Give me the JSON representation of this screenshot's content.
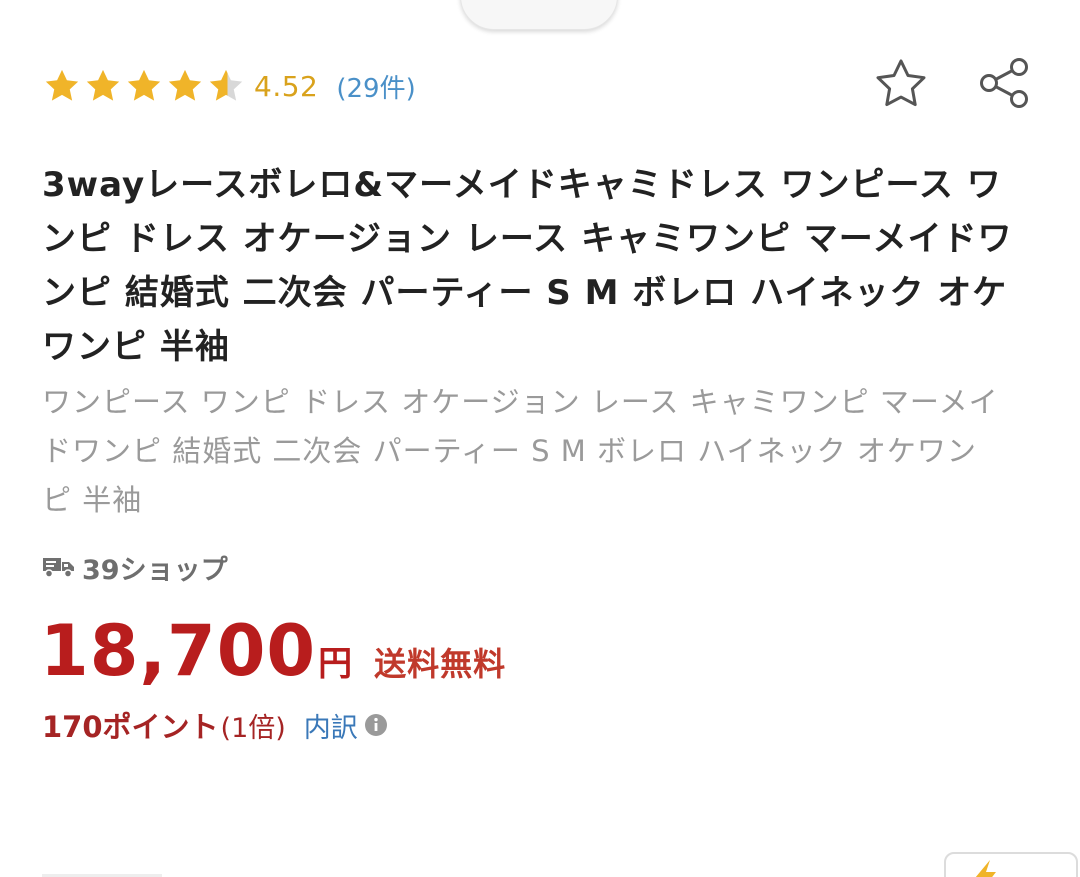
{
  "rating": {
    "value": "4.52",
    "count_label": "(29件)",
    "stars_filled": 4.5
  },
  "actions": {
    "favorite_icon": "star-outline-icon",
    "share_icon": "share-icon"
  },
  "product": {
    "title": "3wayレースボレロ&マーメイドキャミドレス ワンピース ワンピ ドレス オケージョン レース キャミワンピ マーメイドワンピ 結婚式 二次会 パーティー S M ボレロ ハイネック オケワンピ 半袖",
    "description": "ワンピース ワンピ ドレス オケージョン レース キャミワンピ マーメイドワンピ 結婚式 二次会 パーティー S M ボレロ ハイネック オケワンピ 半袖"
  },
  "shop": {
    "icon": "delivery-truck-icon",
    "name": "39ショップ"
  },
  "price": {
    "value": "18,700",
    "unit": "円",
    "shipping_label": "送料無料"
  },
  "points": {
    "label": "170ポイント",
    "multiplier": "(1倍)",
    "breakdown_label": "内訳",
    "info_icon": "info-icon"
  },
  "colors": {
    "star": "#F0B429",
    "rating_text": "#D9A21C",
    "review_link": "#4A90C8",
    "price": "#B81D1D",
    "points": "#A52424",
    "link": "#3A78B8"
  }
}
